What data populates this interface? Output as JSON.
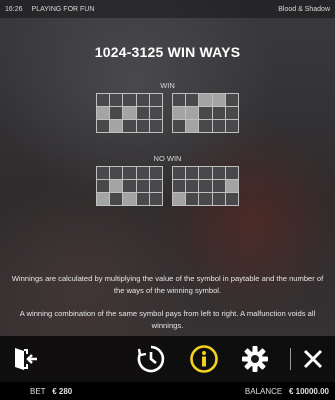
{
  "topbar": {
    "time": "16:26",
    "mode": "PLAYING FOR FUN",
    "game_title": "Blood & Shadow"
  },
  "title": "1024-3125 WIN WAYS",
  "win_label": "WIN",
  "nowin_label": "NO WIN",
  "grids": {
    "win_left": [
      [
        0,
        0,
        0,
        0,
        0
      ],
      [
        1,
        0,
        1,
        0,
        0
      ],
      [
        0,
        1,
        0,
        0,
        0
      ]
    ],
    "win_right": [
      [
        0,
        0,
        1,
        1,
        0
      ],
      [
        1,
        1,
        0,
        0,
        0
      ],
      [
        0,
        1,
        0,
        0,
        0
      ]
    ],
    "nowin_left": [
      [
        0,
        0,
        0,
        0,
        0
      ],
      [
        0,
        1,
        0,
        0,
        0
      ],
      [
        1,
        0,
        1,
        0,
        0
      ]
    ],
    "nowin_right": [
      [
        0,
        0,
        0,
        0,
        0
      ],
      [
        0,
        0,
        0,
        0,
        1
      ],
      [
        1,
        0,
        0,
        0,
        0
      ]
    ]
  },
  "colors": {
    "cell_on": "#a4a4a4",
    "cell_off": "#3c3c3e",
    "accent_yellow": "#f2d21f"
  },
  "text": {
    "para1": "Winnings are calculated by multiplying the value of the symbol in paytable and the number of the ways of the winning symbol.",
    "para2": "A winning combination of the same symbol pays from left to right. A malfunction voids all winnings."
  },
  "toolbar": {
    "exit_icon": "exit-door-icon",
    "history_icon": "clock-history-icon",
    "info_icon": "info-icon",
    "settings_icon": "gear-icon",
    "close_icon": "close-icon",
    "active": "info"
  },
  "status": {
    "bet_label": "BET",
    "bet_value": "€  280",
    "balance_label": "BALANCE",
    "balance_value": "€  10000.00"
  }
}
